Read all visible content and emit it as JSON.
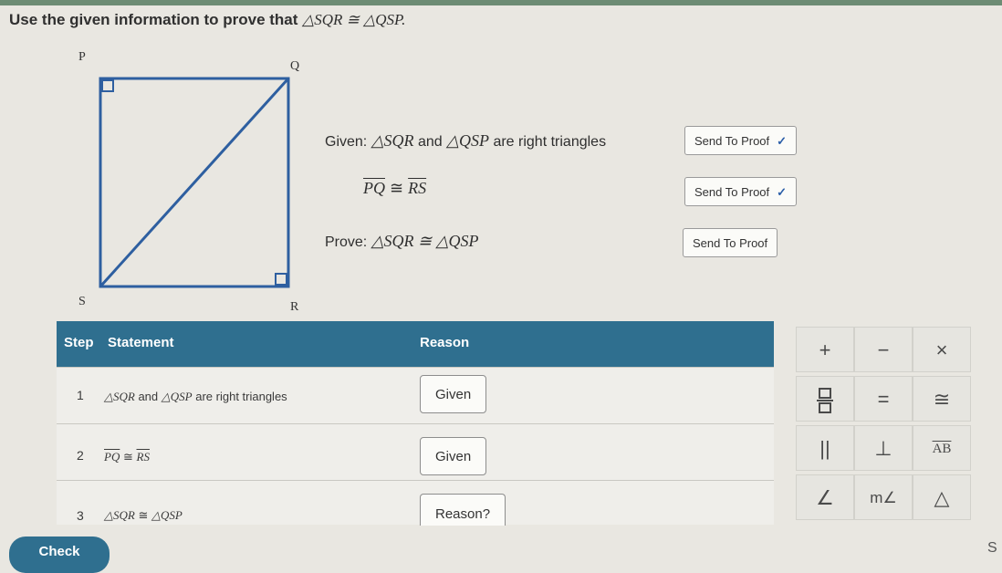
{
  "instruction": {
    "prefix": "Use the given information to prove that",
    "math": "△SQR ≅ △QSP."
  },
  "diagram": {
    "labels": {
      "P": "P",
      "Q": "Q",
      "S": "S",
      "R": "R"
    }
  },
  "given": {
    "line1_prefix": "Given:",
    "line1_math_a": "△SQR",
    "line1_and": "and",
    "line1_math_b": "△QSP",
    "line1_suffix": "are right triangles",
    "line2_a": "PQ",
    "line2_cong": "≅",
    "line2_b": "RS",
    "prove_prefix": "Prove:",
    "prove_math": "△SQR ≅ △QSP",
    "send1": "Send To Proof",
    "send2": "Send To Proof",
    "send3": "Send To Proof",
    "check_mark": "✓"
  },
  "table": {
    "headers": {
      "step": "Step",
      "statement": "Statement",
      "reason": "Reason"
    },
    "rows": [
      {
        "step": "1",
        "stmt_a": "△SQR",
        "stmt_mid": "and",
        "stmt_b": "△QSP",
        "stmt_suffix": "are right triangles",
        "reason": "Given"
      },
      {
        "step": "2",
        "stmt_a": "PQ",
        "stmt_mid": "≅",
        "stmt_b": "RS",
        "reason": "Given"
      },
      {
        "step": "3",
        "stmt_a": "△SQR",
        "stmt_mid": "≅",
        "stmt_b": "△QSP",
        "reason": "Reason?"
      }
    ]
  },
  "keypad": {
    "keys": [
      "+",
      "−",
      "×",
      "□/□",
      "=",
      "≅",
      "||",
      "⊥",
      "AB",
      "∠",
      "m∠",
      "△"
    ]
  },
  "footer": {
    "check": "Check",
    "corner": "S"
  }
}
